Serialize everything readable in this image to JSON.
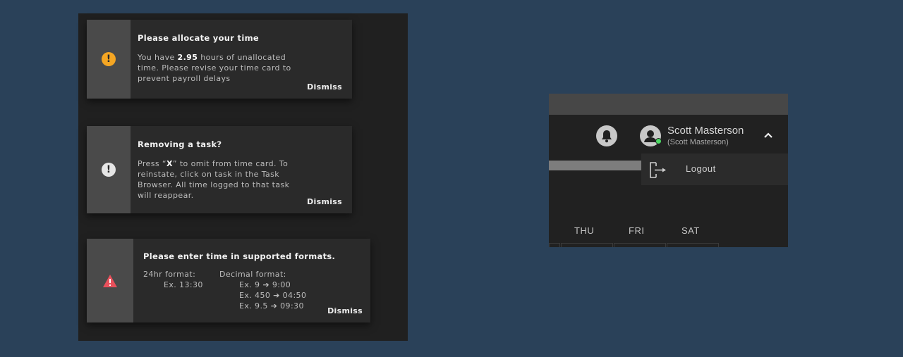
{
  "notifications": [
    {
      "title": "Please allocate your time",
      "body_pre": "You have ",
      "body_bold": "2.95",
      "body_post": " hours of unallocated time. Please revise your time card to prevent payroll delays",
      "dismiss": "Dismiss",
      "icon": "warning-circle-icon",
      "icon_color": "#f5a623"
    },
    {
      "title": "Removing a task?",
      "body_pre": "Press “",
      "body_bold": "X",
      "body_post": "” to omit from time card. To reinstate, click on task in the Task Browser. All time logged to that task will reappear.",
      "dismiss": "Dismiss",
      "icon": "info-circle-icon",
      "icon_color": "#e6e6e6"
    },
    {
      "title": "Please enter time in supported formats.",
      "format_24_label": "24hr format:",
      "format_24_example": "Ex. 13:30",
      "decimal_label": "Decimal format:",
      "decimal_examples": [
        "Ex. 9 ➔ 9:00",
        "Ex. 450 ➔ 04:50",
        "Ex. 9.5 ➔ 09:30"
      ],
      "dismiss": "Dismiss",
      "icon": "error-triangle-icon",
      "icon_color": "#e8505b"
    }
  ],
  "header": {
    "user_name": "Scott Masterson",
    "user_sub": "(Scott Masterson)",
    "status_color": "#4cd964"
  },
  "user_menu": {
    "logout_label": "Logout"
  },
  "week_days": [
    "THU",
    "FRI",
    "SAT"
  ]
}
